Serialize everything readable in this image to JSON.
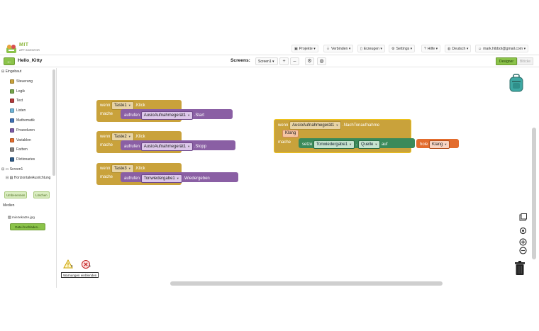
{
  "app": {
    "logo_text": "MIT",
    "logo_subtext": "APP INVENTOR",
    "nav": [
      {
        "label": "Projekte",
        "icon": "folder-icon"
      },
      {
        "label": "Verbinden",
        "icon": "plug-icon"
      },
      {
        "label": "Erzeugen",
        "icon": "phone-icon"
      },
      {
        "label": "Settings",
        "icon": "gear-icon"
      },
      {
        "label": "Hilfe",
        "icon": "help-icon"
      },
      {
        "label": "Deutsch",
        "icon": "globe-icon"
      },
      {
        "label": "mark.hibbot@gmail.com",
        "icon": "user-icon"
      }
    ]
  },
  "toolbar": {
    "back_icon": "arrow-left-icon",
    "project_name": "Hello_Kitty",
    "screens_label": "Screens:",
    "screen_selected": "Screen1",
    "add_label": "+",
    "remove_label": "–",
    "designer_label": "Designer",
    "blocks_label": "Blöcke"
  },
  "sidebar": {
    "builtin_label": "Eingebaut",
    "builtin_items": [
      {
        "label": "Steuerung",
        "color": "#c9a23b"
      },
      {
        "label": "Logik",
        "color": "#75a44b"
      },
      {
        "label": "Text",
        "color": "#b23a3a"
      },
      {
        "label": "Listen",
        "color": "#6fb4d8"
      },
      {
        "label": "Mathematik",
        "color": "#3f71b5"
      },
      {
        "label": "Prozeduren",
        "color": "#7c5ba6"
      },
      {
        "label": "Variablen",
        "color": "#e36c2d"
      },
      {
        "label": "Farben",
        "color": "#808080"
      },
      {
        "label": "Dictionaries",
        "color": "#2d5a87"
      }
    ],
    "screen_label": "Screen1",
    "component_label": "HorizontaleAusrichtung",
    "rename_button": "Umbenennen",
    "delete_button": "Löschen",
    "media_label": "Medien",
    "media_file": "miezekatze.jpg",
    "upload_button": "Datei hochladen..."
  },
  "workspace": {
    "event_blocks": [
      {
        "when": "wenn",
        "component": "Taste1",
        "event": ".Klick",
        "do": "mache",
        "call": "aufrufen",
        "target": "AusioAufnahmegerät1",
        "method": ".Start"
      },
      {
        "when": "wenn",
        "component": "Taste2",
        "event": ".Klick",
        "do": "mache",
        "call": "aufrufen",
        "target": "AusioAufnahmegerät1",
        "method": ".Stopp"
      },
      {
        "when": "wenn",
        "component": "Taste3",
        "event": ".Klick",
        "do": "mache",
        "call": "aufrufen",
        "target": "Tonwiedergabe1",
        "method": ".Wiedergeben"
      }
    ],
    "recorder_event": {
      "when": "wenn",
      "component": "AusioAufnahmegerät1",
      "event": ".NachTonaufnahme",
      "param": "Klang",
      "do": "mache",
      "set": "setze",
      "set_target": "Tonwiedergabe1",
      "set_prop": "Quelle",
      "to": "auf",
      "get": "hole",
      "get_var": "Klang"
    },
    "warnings": {
      "warning_count": "0",
      "error_count": "0",
      "show_label": "Warnungen einblenden"
    }
  },
  "colors": {
    "control": "#c9a23b",
    "procedure_call": "#8a5fa4",
    "setter": "#3b8a5a",
    "variable": "#e36c2d",
    "accent": "#8bc34a"
  }
}
